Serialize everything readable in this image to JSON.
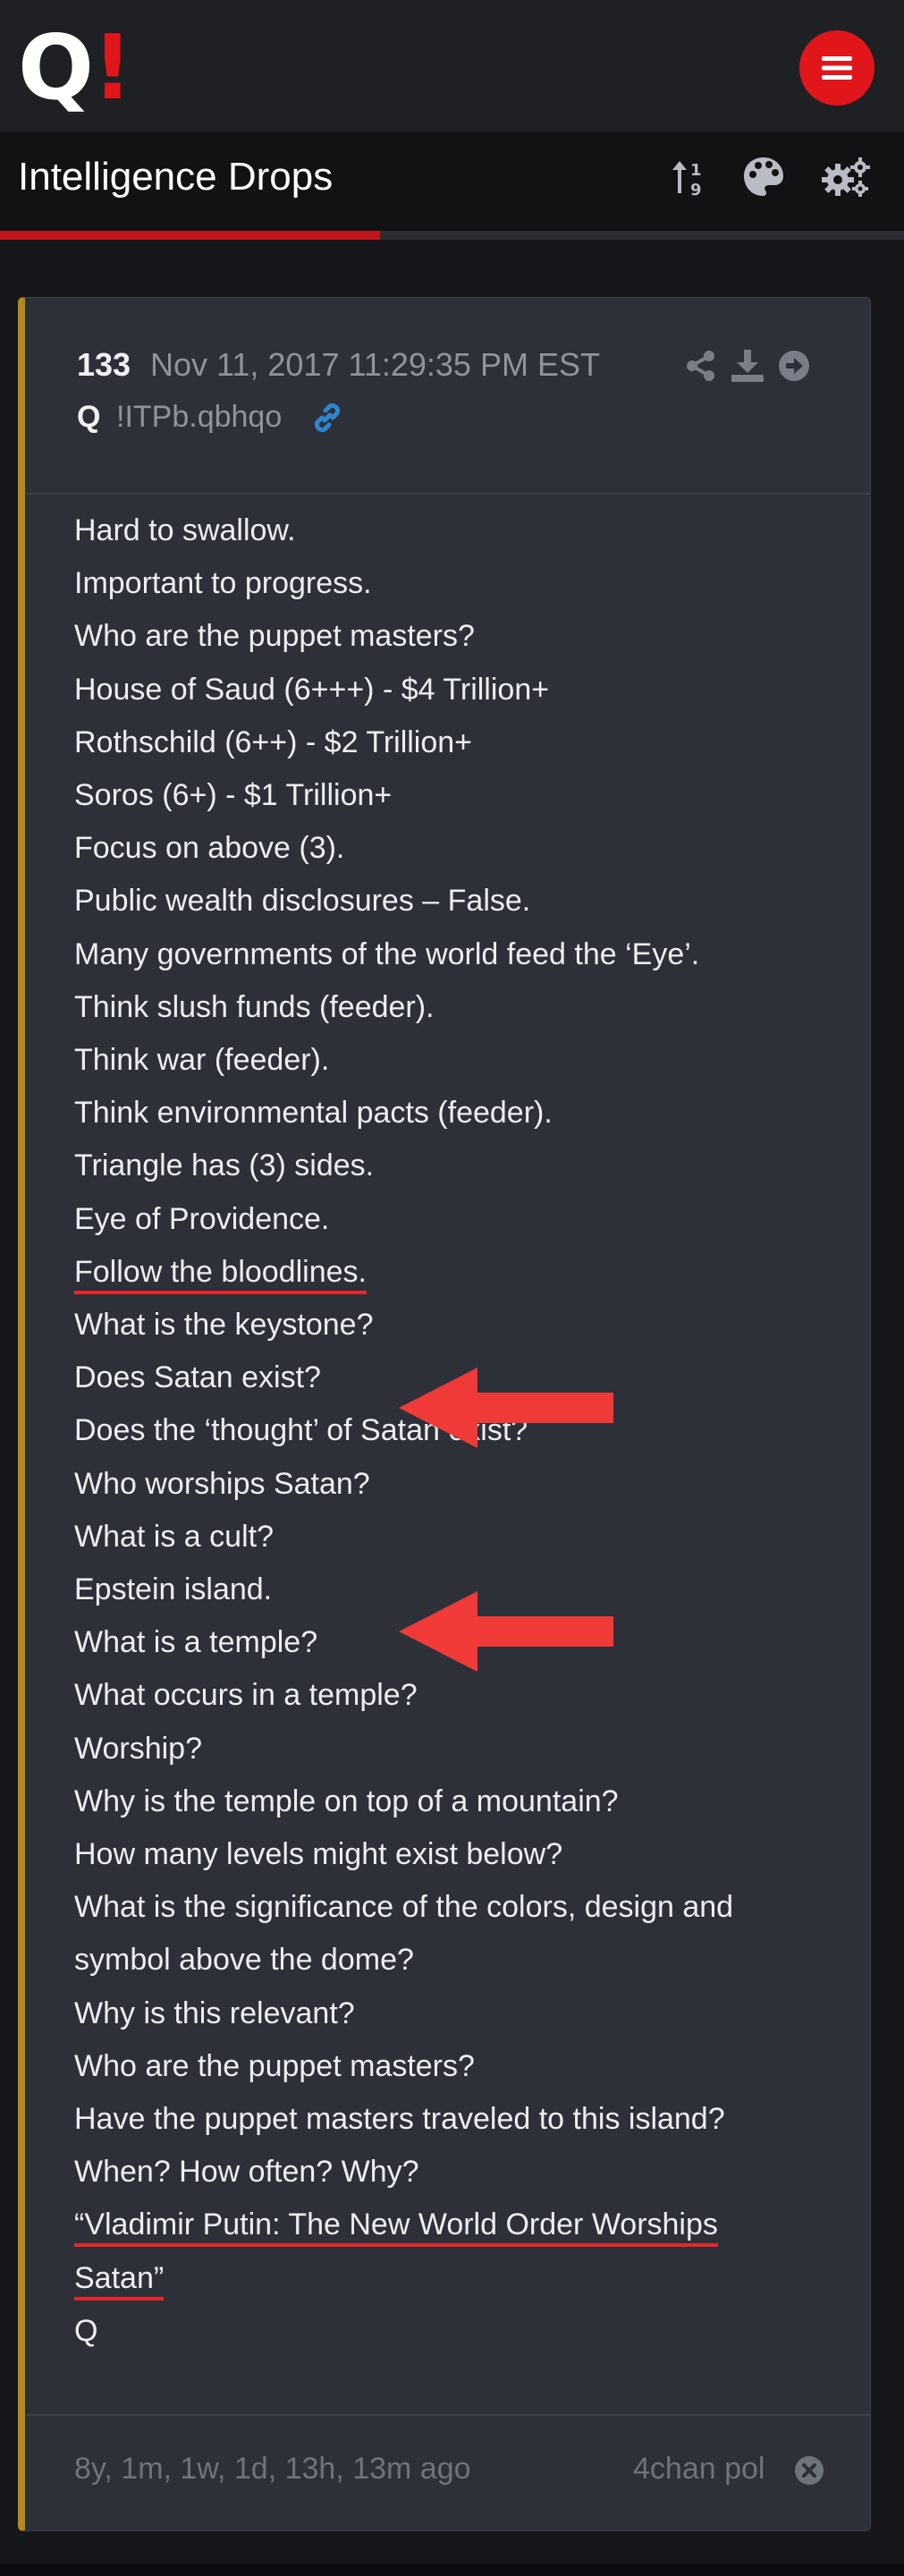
{
  "app": {
    "logo_letter": "Q",
    "logo_mark": "!",
    "brand_color": "#e0161b",
    "menu_icon": "hamburger-icon"
  },
  "subheader": {
    "title": "Intelligence Drops",
    "icons": [
      "sort-icon",
      "palette-icon",
      "settings-icon"
    ],
    "progress_percent": 42
  },
  "post": {
    "number": "133",
    "date": "Nov 11, 2017 11:29:35 PM EST",
    "author": "Q",
    "tripcode": "!ITPb.qbhqo",
    "link_icon": "link-icon",
    "actions": [
      "share-icon",
      "download-icon",
      "open-icon"
    ],
    "accent_color": "#b5891c",
    "lines": [
      "Hard to swallow.",
      "Important to progress.",
      "Who are the puppet masters?",
      "House of Saud (6+++) - $4 Trillion+",
      "Rothschild (6++) - $2 Trillion+",
      "Soros (6+) - $1 Trillion+",
      "Focus on above (3).",
      "Public wealth disclosures – False.",
      "Many governments of the world feed the ‘Eye’.",
      "Think slush funds (feeder).",
      "Think war (feeder).",
      "Think environmental pacts (feeder).",
      "Triangle has (3) sides.",
      "Eye of Providence.",
      "Follow the bloodlines.",
      "What is the keystone?",
      "Does Satan exist?",
      "Does the ‘thought’ of Satan exist?",
      "Who worships Satan?",
      "What is a cult?",
      "Epstein island.",
      "What is a temple?",
      "What occurs in a temple?",
      "Worship?",
      "Why is the temple on top of a mountain?",
      "How many levels might exist below?",
      "What is the significance of the colors, design and",
      "symbol above the dome?",
      "Why is this relevant?",
      "Who are the puppet masters?",
      "Have the puppet masters traveled to this island?",
      "When? How often? Why?",
      " “Vladimir Putin: The New World Order Worships",
      "Satan”",
      "Q"
    ],
    "footer_ago": "8y, 1m, 1w, 1d, 13h, 13m ago",
    "footer_source": "4chan pol",
    "footer_icon": "close-icon",
    "annotation_color": "#e8262b"
  }
}
